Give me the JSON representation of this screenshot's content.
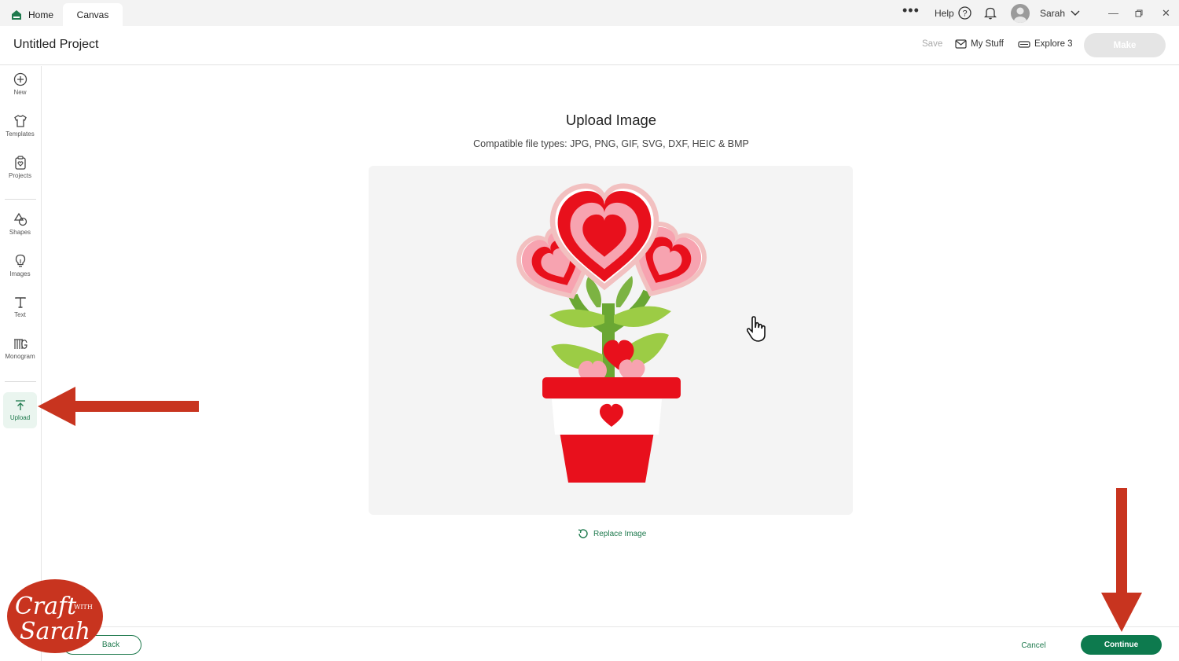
{
  "titlebar": {
    "tabs": [
      {
        "label": "Home",
        "icon": "home-icon"
      },
      {
        "label": "Canvas"
      }
    ],
    "help_label": "Help",
    "user_name": "Sarah",
    "accent_color": "#1f7a4e"
  },
  "header": {
    "project_title": "Untitled Project",
    "save_label": "Save",
    "my_stuff_label": "My Stuff",
    "machine_label": "Explore 3",
    "make_label": "Make"
  },
  "sidebar": {
    "items": [
      {
        "label": "New",
        "icon": "plus-circle-icon"
      },
      {
        "label": "Templates",
        "icon": "shirt-icon"
      },
      {
        "label": "Projects",
        "icon": "clipboard-heart-icon"
      },
      {
        "label": "Shapes",
        "icon": "shapes-icon"
      },
      {
        "label": "Images",
        "icon": "lightbulb-icon"
      },
      {
        "label": "Text",
        "icon": "text-t-icon"
      },
      {
        "label": "Monogram",
        "icon": "monogram-icon"
      },
      {
        "label": "Upload",
        "icon": "upload-arrow-icon",
        "active": true
      }
    ]
  },
  "main": {
    "title": "Upload Image",
    "subtitle": "Compatible file types:  JPG, PNG, GIF, SVG, DXF, HEIC & BMP",
    "replace_label": "Replace Image"
  },
  "footer": {
    "back_label": "Back",
    "cancel_label": "Cancel",
    "continue_label": "Continue"
  },
  "watermark": {
    "line1": "Craft",
    "line2": "WITH",
    "line3": "Sarah",
    "color": "#c8341f"
  }
}
